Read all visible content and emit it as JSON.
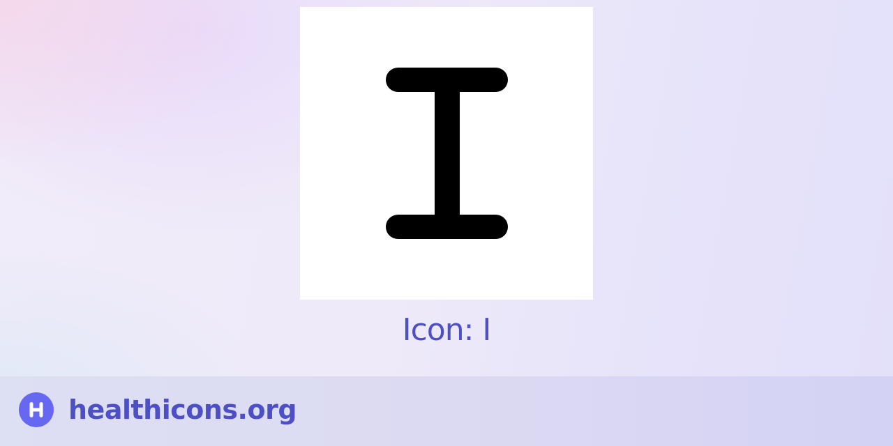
{
  "caption": "Icon: I",
  "footer": {
    "site_name": "healthicons.org"
  },
  "icon": {
    "name": "letter-i-icon"
  },
  "logo": {
    "name": "healthicons-logo-icon",
    "color": "#6668f2"
  },
  "colors": {
    "accent": "#4d4fc4",
    "icon_fill": "#000000",
    "card_background": "#ffffff"
  }
}
